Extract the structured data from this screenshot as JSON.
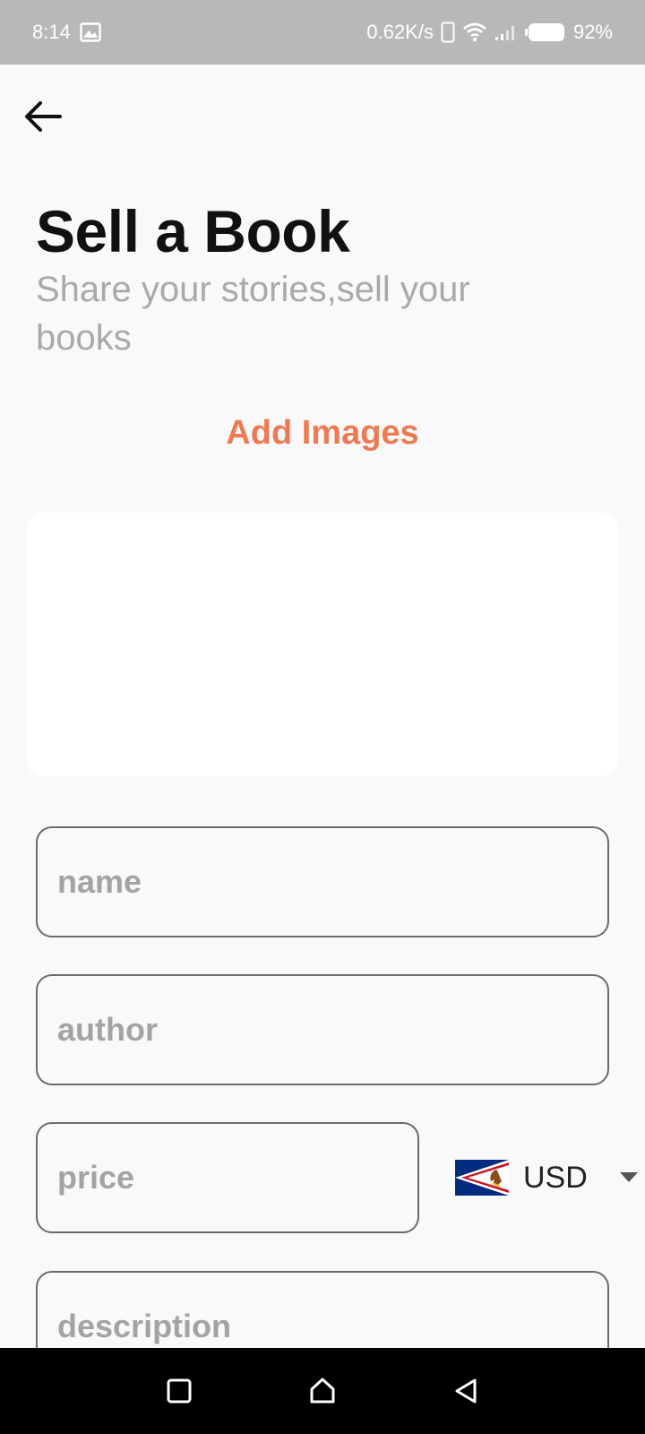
{
  "status_bar": {
    "time": "8:14",
    "network_speed": "0.62K/s",
    "battery": "92%"
  },
  "header": {
    "title": "Sell a Book",
    "subtitle": "Share your stories,sell your books"
  },
  "images": {
    "add_label": "Add Images"
  },
  "form": {
    "name_placeholder": "name",
    "author_placeholder": "author",
    "price_placeholder": "price",
    "description_placeholder": "description",
    "currency": "USD"
  },
  "colors": {
    "accent": "#ec7a52",
    "placeholder": "#a3a3a3",
    "subtitle": "#a9a9a9",
    "status_bar": "#b8b8b8"
  },
  "icons": {
    "back": "arrow-left-icon",
    "dropdown": "caret-down-icon",
    "flag": "american-samoa-flag-icon",
    "nav_recent": "square-icon",
    "nav_home": "home-icon",
    "nav_back": "triangle-back-icon"
  }
}
